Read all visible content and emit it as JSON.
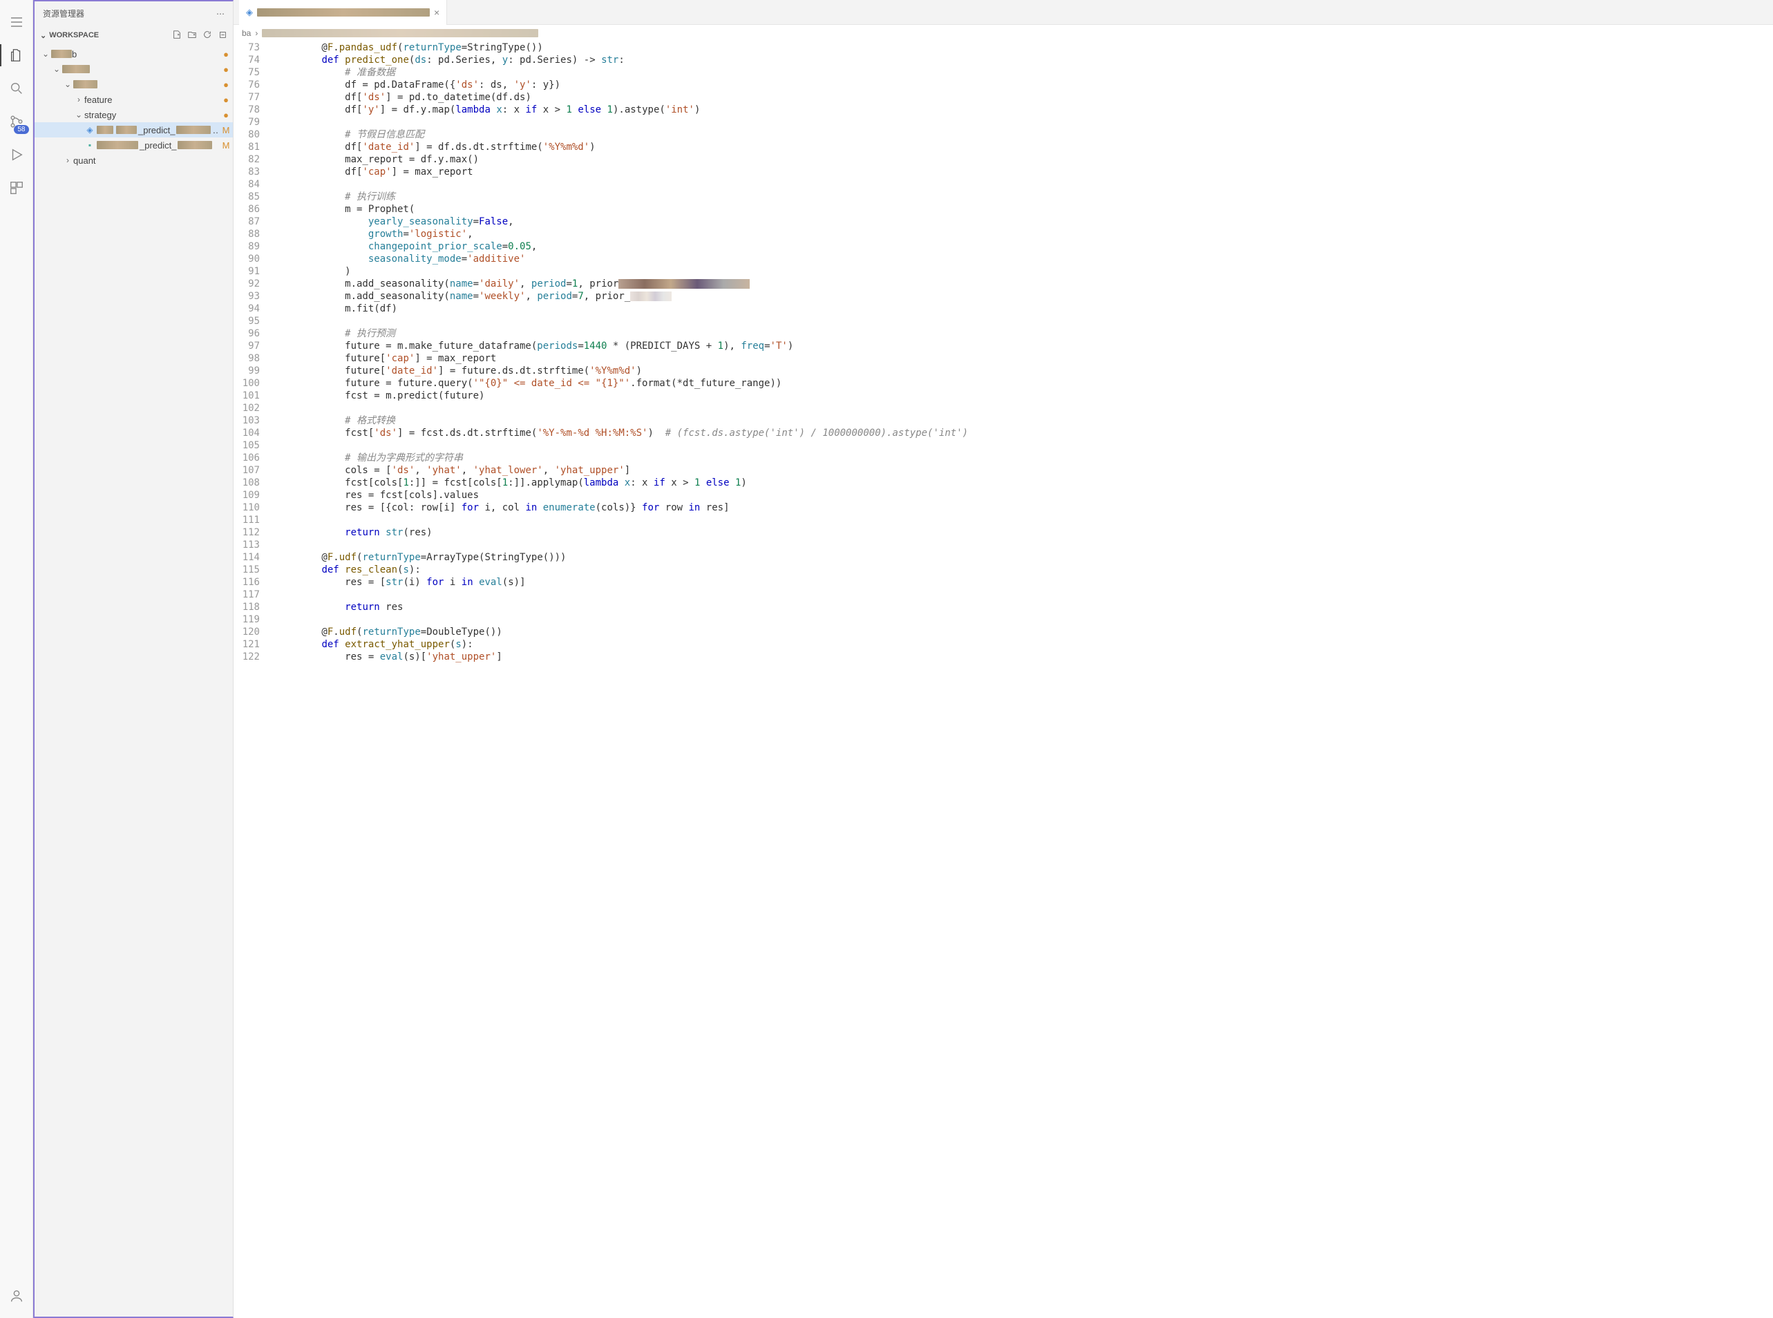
{
  "sidebar_title": "资源管理器",
  "workspace_label": "WORKSPACE",
  "badge_count": "58",
  "tree": {
    "root_label": "b",
    "folder1": "",
    "feature": "feature",
    "strategy": "strategy",
    "file1_suffix": "_predict_",
    "file1_status": "M",
    "file2_suffix": "_predict_",
    "file2_status": "M",
    "quant": "quant"
  },
  "breadcrumb_first": "ba",
  "tab_close": "×",
  "code": {
    "lines": [
      {
        "n": 73,
        "html": "        @<span class='deco'>F</span>.<span class='fn'>pandas_udf</span>(<span class='param'>returnType</span>=StringType())"
      },
      {
        "n": 74,
        "html": "        <span class='kw'>def</span> <span class='fn'>predict_one</span>(<span class='param'>ds</span>: pd.Series, <span class='param'>y</span>: pd.Series) -&gt; <span class='builtin'>str</span>:"
      },
      {
        "n": 75,
        "html": "            <span class='cm'># 准备数据</span>"
      },
      {
        "n": 76,
        "html": "            df = pd.DataFrame({<span class='str'>'ds'</span>: ds, <span class='str'>'y'</span>: y})"
      },
      {
        "n": 77,
        "html": "            df[<span class='str'>'ds'</span>] = pd.to_datetime(df.ds)"
      },
      {
        "n": 78,
        "html": "            df[<span class='str'>'y'</span>] = df.y.map(<span class='kw'>lambda</span> <span class='param'>x</span>: x <span class='kw'>if</span> x &gt; <span class='num'>1</span> <span class='kw'>else</span> <span class='num'>1</span>).astype(<span class='str'>'int'</span>)"
      },
      {
        "n": 79,
        "html": ""
      },
      {
        "n": 80,
        "html": "            <span class='cm'># 节假日信息匹配</span>"
      },
      {
        "n": 81,
        "html": "            df[<span class='str'>'date_id'</span>] = df.ds.dt.strftime(<span class='str'>'%Y%m%d'</span>)"
      },
      {
        "n": 82,
        "html": "            max_report = df.y.max()"
      },
      {
        "n": 83,
        "html": "            df[<span class='str'>'cap'</span>] = max_report"
      },
      {
        "n": 84,
        "html": ""
      },
      {
        "n": 85,
        "html": "            <span class='cm'># 执行训练</span>"
      },
      {
        "n": 86,
        "html": "            m = Prophet("
      },
      {
        "n": 87,
        "html": "                <span class='param'>yearly_seasonality</span>=<span class='kw'>False</span>,"
      },
      {
        "n": 88,
        "html": "                <span class='param'>growth</span>=<span class='str'>'logistic'</span>,"
      },
      {
        "n": 89,
        "html": "                <span class='param'>changepoint_prior_scale</span>=<span class='num'>0.05</span>,"
      },
      {
        "n": 90,
        "html": "                <span class='param'>seasonality_mode</span>=<span class='str'>'additive'</span>"
      },
      {
        "n": 91,
        "html": "            )"
      },
      {
        "n": 92,
        "html": "            m.add_seasonality(<span class='param'>name</span>=<span class='str'>'daily'</span>, <span class='param'>period</span>=<span class='num'>1</span>, prior<span class='blurred-code' style='width:190px'></span>"
      },
      {
        "n": 93,
        "html": "            m.add_seasonality(<span class='param'>name</span>=<span class='str'>'weekly'</span>, <span class='param'>period</span>=<span class='num'>7</span>, prior_<span class='blurred-code' style='width:60px;opacity:0.3'></span>"
      },
      {
        "n": 94,
        "html": "            m.fit(df)"
      },
      {
        "n": 95,
        "html": ""
      },
      {
        "n": 96,
        "html": "            <span class='cm'># 执行预测</span>"
      },
      {
        "n": 97,
        "html": "            future = m.make_future_dataframe(<span class='param'>periods</span>=<span class='num'>1440</span> * (PREDICT_DAYS + <span class='num'>1</span>), <span class='param'>freq</span>=<span class='str'>'T'</span>)"
      },
      {
        "n": 98,
        "html": "            future[<span class='str'>'cap'</span>] = max_report"
      },
      {
        "n": 99,
        "html": "            future[<span class='str'>'date_id'</span>] = future.ds.dt.strftime(<span class='str'>'%Y%m%d'</span>)"
      },
      {
        "n": 100,
        "html": "            future = future.query(<span class='str'>'\"{0}\" &lt;= date_id &lt;= \"{1}\"'</span>.format(*dt_future_range))"
      },
      {
        "n": 101,
        "html": "            fcst = m.predict(future)"
      },
      {
        "n": 102,
        "html": ""
      },
      {
        "n": 103,
        "html": "            <span class='cm'># 格式转换</span>"
      },
      {
        "n": 104,
        "html": "            fcst[<span class='str'>'ds'</span>] = fcst.ds.dt.strftime(<span class='str'>'%Y-%m-%d %H:%M:%S'</span>)  <span class='cm'># (fcst.ds.astype('int') / 1000000000).astype('int')</span>"
      },
      {
        "n": 105,
        "html": ""
      },
      {
        "n": 106,
        "html": "            <span class='cm'># 输出为字典形式的字符串</span>"
      },
      {
        "n": 107,
        "html": "            cols = [<span class='str'>'ds'</span>, <span class='str'>'yhat'</span>, <span class='str'>'yhat_lower'</span>, <span class='str'>'yhat_upper'</span>]"
      },
      {
        "n": 108,
        "html": "            fcst[cols[<span class='num'>1</span>:]] = fcst[cols[<span class='num'>1</span>:]].applymap(<span class='kw'>lambda</span> <span class='param'>x</span>: x <span class='kw'>if</span> x &gt; <span class='num'>1</span> <span class='kw'>else</span> <span class='num'>1</span>)"
      },
      {
        "n": 109,
        "html": "            res = fcst[cols].values"
      },
      {
        "n": 110,
        "html": "            res = [{col: row[i] <span class='kw'>for</span> i, col <span class='kw'>in</span> <span class='builtin'>enumerate</span>(cols)} <span class='kw'>for</span> row <span class='kw'>in</span> res]"
      },
      {
        "n": 111,
        "html": ""
      },
      {
        "n": 112,
        "html": "            <span class='kw'>return</span> <span class='builtin'>str</span>(res)"
      },
      {
        "n": 113,
        "html": ""
      },
      {
        "n": 114,
        "html": "        @<span class='deco'>F</span>.<span class='fn'>udf</span>(<span class='param'>returnType</span>=ArrayType(StringType()))"
      },
      {
        "n": 115,
        "html": "        <span class='kw'>def</span> <span class='fn'>res_clean</span>(<span class='param'>s</span>):"
      },
      {
        "n": 116,
        "html": "            res = [<span class='builtin'>str</span>(i) <span class='kw'>for</span> i <span class='kw'>in</span> <span class='builtin'>eval</span>(s)]"
      },
      {
        "n": 117,
        "html": ""
      },
      {
        "n": 118,
        "html": "            <span class='kw'>return</span> res"
      },
      {
        "n": 119,
        "html": ""
      },
      {
        "n": 120,
        "html": "        @<span class='deco'>F</span>.<span class='fn'>udf</span>(<span class='param'>returnType</span>=DoubleType())"
      },
      {
        "n": 121,
        "html": "        <span class='kw'>def</span> <span class='fn'>extract_yhat_upper</span>(<span class='param'>s</span>):"
      },
      {
        "n": 122,
        "html": "            res = <span class='builtin'>eval</span>(s)[<span class='str'>'yhat_upper'</span>]"
      }
    ]
  }
}
